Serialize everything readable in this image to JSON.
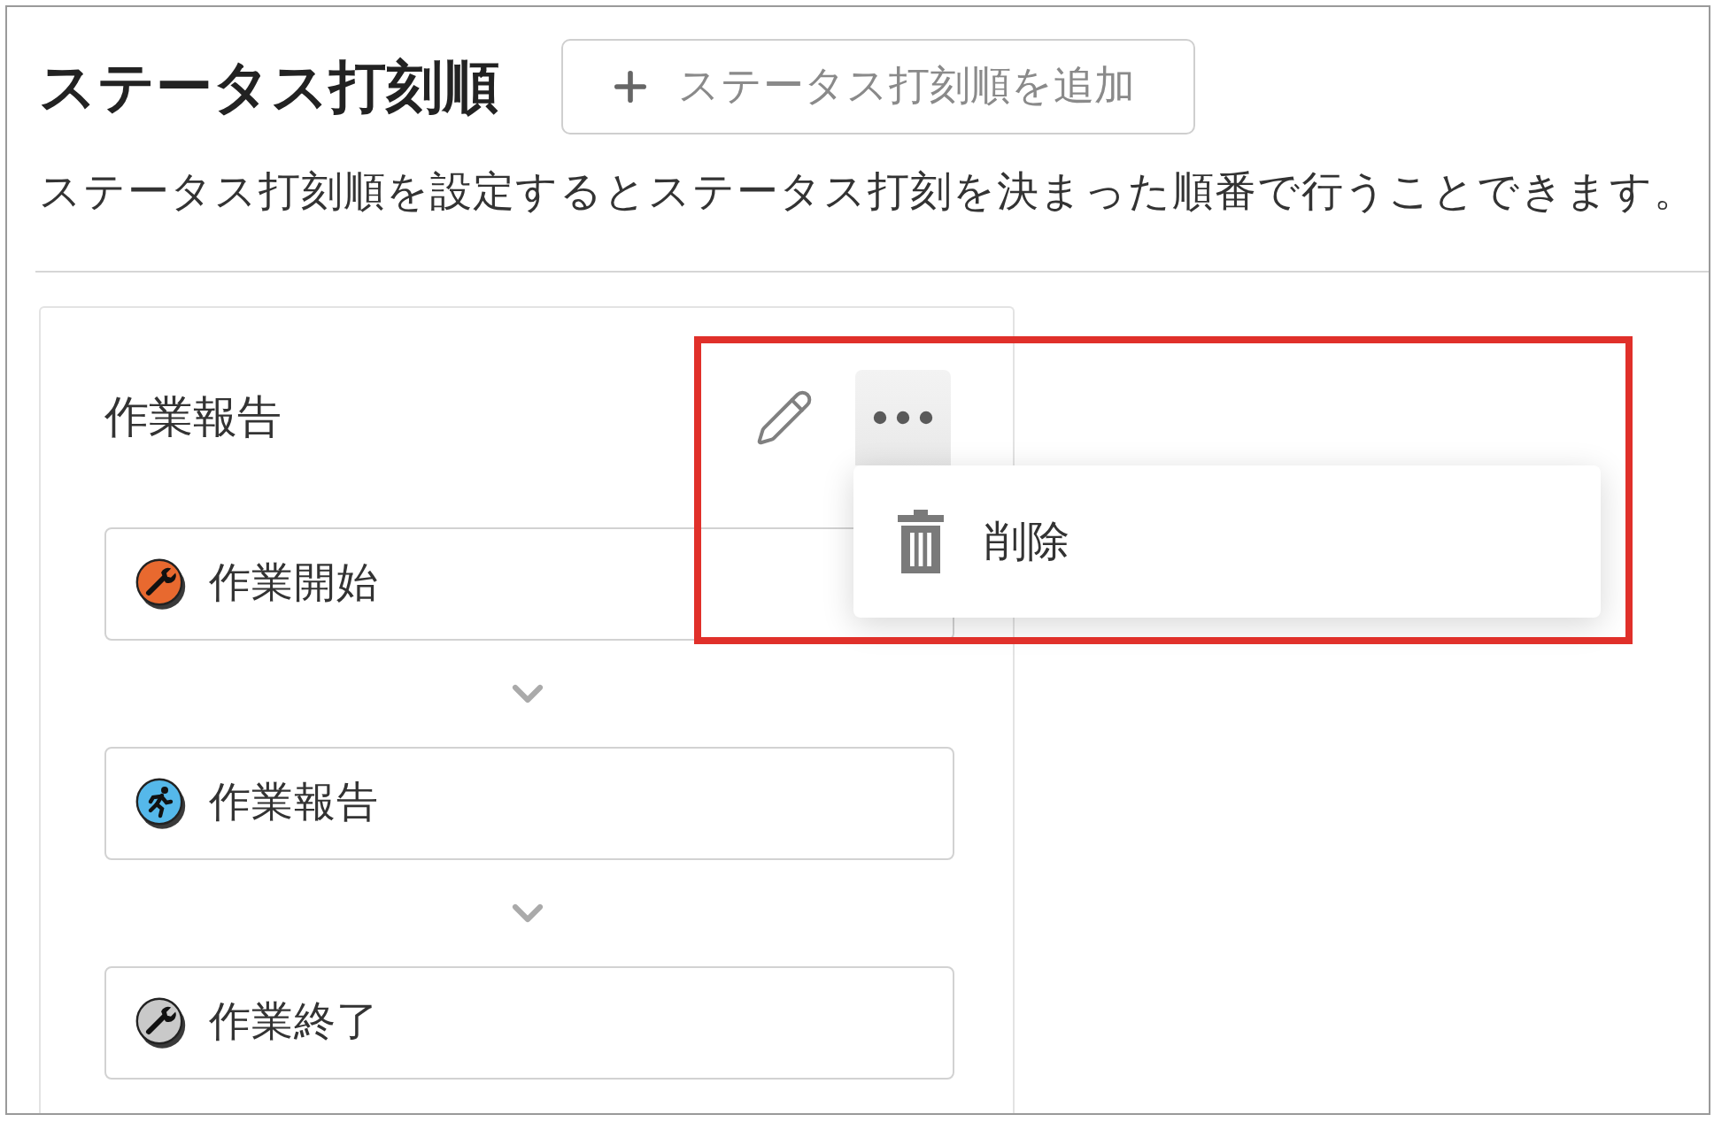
{
  "header": {
    "title": "ステータス打刻順",
    "add_button": {
      "label": "ステータス打刻順を追加"
    },
    "description": "ステータス打刻順を設定するとステータス打刻を決まった順番で行うことできます。"
  },
  "card": {
    "title": "作業報告",
    "menu": {
      "open": true,
      "items": [
        {
          "label": "削除",
          "kind": "delete"
        }
      ]
    },
    "statuses": [
      {
        "label": "作業開始",
        "color": "#e8692f",
        "kind": "wrench"
      },
      {
        "label": "作業報告",
        "color": "#55b8ea",
        "kind": "runner"
      },
      {
        "label": "作業終了",
        "color": "#c9c9c9",
        "kind": "wrench"
      }
    ]
  },
  "annotations": [
    {
      "kind": "rectangle"
    }
  ]
}
